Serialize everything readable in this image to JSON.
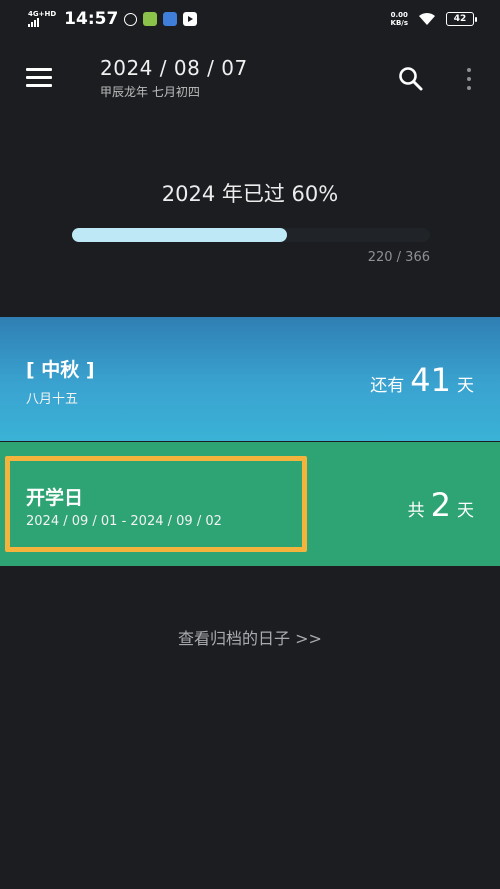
{
  "status_bar": {
    "network": "4G+HD",
    "time": "14:57",
    "speed_value": "0.00",
    "speed_unit": "KB/s",
    "battery": "42"
  },
  "header": {
    "date": "2024 / 08 / 07",
    "lunar_date": "甲辰龙年 七月初四"
  },
  "year_progress": {
    "title": "2024 年已过 60%",
    "days_passed": 220,
    "days_total": 366,
    "count_text": "220 / 366",
    "fill_fraction": 0.6,
    "fill_color": "#bfe8f6"
  },
  "events": [
    {
      "title": "[ 中秋 ]",
      "subtitle": "八月十五",
      "prefix": "还有",
      "number": "41",
      "suffix": "天",
      "color": "#3aa3d0"
    },
    {
      "title": "开学日",
      "subtitle": "2024 / 09 / 01 - 2024 / 09 / 02",
      "prefix": "共",
      "number": "2",
      "suffix": "天",
      "color": "#2ea474"
    }
  ],
  "archive_link": "查看归档的日子 >>",
  "icons": {
    "menu": "hamburger-menu-icon",
    "search": "search-icon",
    "more": "more-vertical-icon"
  },
  "colors": {
    "background": "#1b1d20",
    "highlight": "#f3b33c"
  }
}
